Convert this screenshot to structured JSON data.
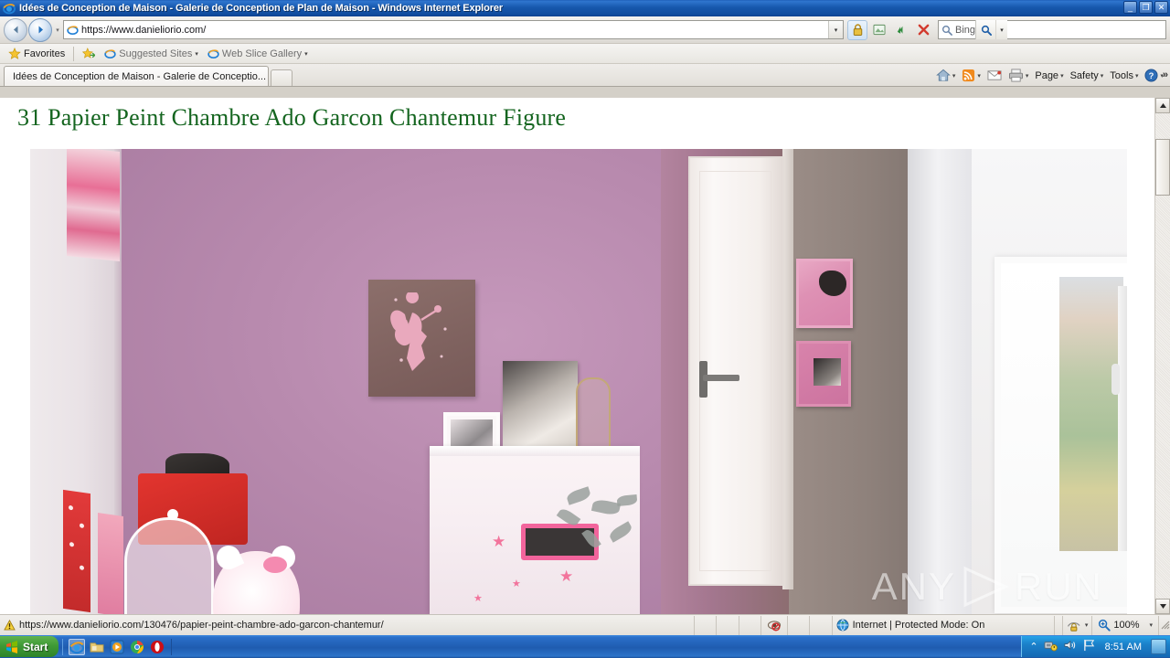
{
  "window": {
    "title": "Idées de Conception de Maison - Galerie de Conception de Plan de Maison - Windows Internet Explorer",
    "minimize_label": "_",
    "maximize_label": "❐",
    "close_label": "✕"
  },
  "navbar": {
    "back_icon": "back-arrow-icon",
    "forward_icon": "forward-arrow-icon",
    "recent_pages_caret": "▾",
    "address_value": "https://www.danieliorio.com/",
    "address_dropdown_caret": "▾",
    "buttons": [
      {
        "name": "security-lock-icon",
        "label": ""
      },
      {
        "name": "compatibility-view-icon",
        "label": ""
      },
      {
        "name": "refresh-icon",
        "label": ""
      },
      {
        "name": "stop-icon",
        "label": ""
      }
    ],
    "search_placeholder": "Bing",
    "search_go_icon": "search-icon",
    "search_caret": "▾"
  },
  "favorites_bar": {
    "favorites_label": "Favorites",
    "items": [
      {
        "label": "Suggested Sites",
        "caret": "▾"
      },
      {
        "label": "Web Slice Gallery",
        "caret": "▾"
      }
    ]
  },
  "tabs": {
    "active_tab_label": "Idées de Conception de Maison - Galerie de Conceptio...",
    "new_tab_label": ""
  },
  "command_bar": {
    "items": [
      {
        "label": "",
        "icon": "home-icon",
        "caret": "▾"
      },
      {
        "label": "",
        "icon": "rss-feeds-icon",
        "caret": "▾"
      },
      {
        "label": "",
        "icon": "mail-icon",
        "caret": ""
      },
      {
        "label": "",
        "icon": "print-icon",
        "caret": "▾"
      },
      {
        "label": "Page",
        "icon": "",
        "caret": "▾"
      },
      {
        "label": "Safety",
        "icon": "",
        "caret": "▾"
      },
      {
        "label": "Tools",
        "icon": "",
        "caret": "▾"
      },
      {
        "label": "",
        "icon": "help-icon",
        "caret": "▾"
      }
    ],
    "overflow_label": "»"
  },
  "page": {
    "heading": "31 Papier Peint Chambre Ado Garcon Chantemur Figure",
    "heading_color": "#14651f",
    "photo_alt": "Pink girls bedroom with fairy canvas, white dresser, door and window",
    "watermark_left": "ANY",
    "watermark_right": "RUN"
  },
  "scrollbar": {
    "up_arrow": "▲",
    "down_arrow": "▼"
  },
  "statusbar": {
    "url": "https://www.danieliorio.com/130476/papier-peint-chambre-ado-garcon-chantemur/",
    "warning_icon": "warning-icon",
    "blocked_icon": "popup-blocked-icon",
    "zone": "Internet | Protected Mode: On",
    "zone_icon": "internet-zone-icon",
    "privacy_icon": "privacy-report-icon",
    "privacy_caret": "▾",
    "zoom_icon": "zoom-icon",
    "zoom_level": "100%",
    "zoom_caret": "▾"
  },
  "taskbar": {
    "start_label": "Start",
    "quick_launch": [
      {
        "name": "taskbar-internet-explorer",
        "label": ""
      },
      {
        "name": "taskbar-file-explorer",
        "label": ""
      },
      {
        "name": "taskbar-media-player",
        "label": ""
      },
      {
        "name": "taskbar-chrome",
        "label": ""
      },
      {
        "name": "taskbar-opera",
        "label": ""
      }
    ],
    "tray_expand": "⌃",
    "tray_icons": [
      {
        "name": "network-icon"
      },
      {
        "name": "volume-icon"
      },
      {
        "name": "flag-action-center-icon"
      }
    ],
    "clock": "8:51 AM",
    "show_desktop_label": ""
  }
}
